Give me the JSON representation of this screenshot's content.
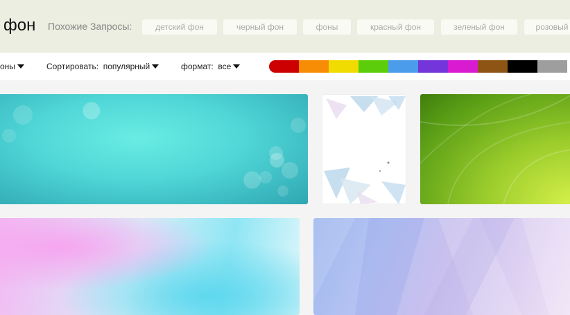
{
  "search": {
    "query": "фон"
  },
  "related": {
    "label": "Похожие Запросы:",
    "chips": [
      "детский фон",
      "черный фон",
      "фоны",
      "красный фон",
      "зеленый фон",
      "розовый"
    ]
  },
  "filters": {
    "type_value": "оны",
    "sort_label": "Сортировать:",
    "sort_value": "популярный",
    "format_label": "формат:",
    "format_value": "все"
  },
  "color_swatches": [
    "#cc0000",
    "#f78c05",
    "#f0dc00",
    "#5ccd0a",
    "#4b9cea",
    "#7435da",
    "#d81bd0",
    "#8d5414",
    "#000000",
    "#9e9e9e"
  ],
  "images": [
    {
      "name": "teal-bokeh"
    },
    {
      "name": "white-triangles"
    },
    {
      "name": "green-curves"
    },
    {
      "name": "pink-blue-watercolor"
    },
    {
      "name": "lavender-geometric"
    }
  ]
}
